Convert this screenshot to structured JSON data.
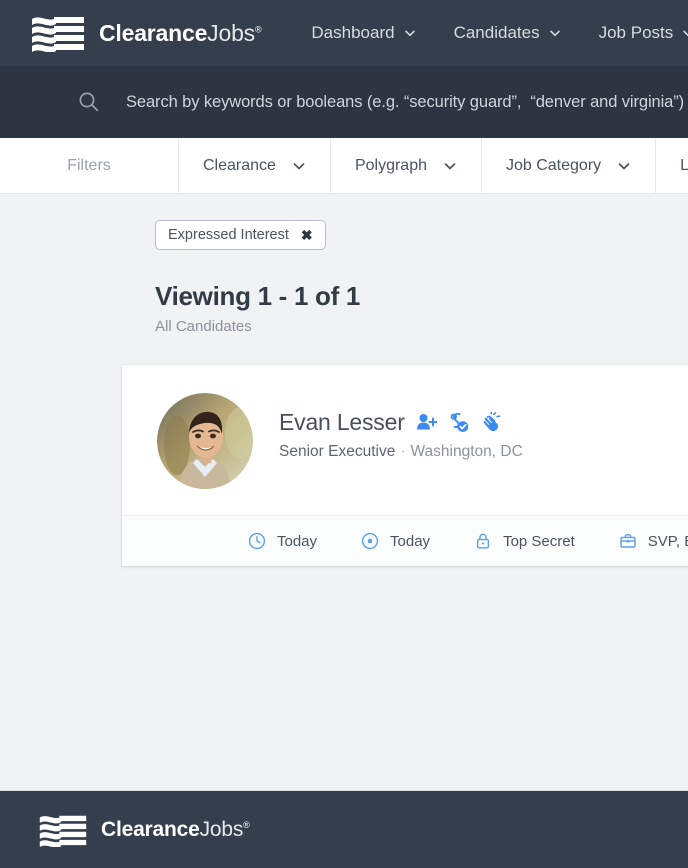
{
  "brand": {
    "name_bold": "Clearance",
    "name_light": "Jobs",
    "registered": "®",
    "logo_icon": "flag-stripes-logo"
  },
  "nav": {
    "items": [
      {
        "label": "Dashboard",
        "icon": "chevron-down-icon"
      },
      {
        "label": "Candidates",
        "icon": "chevron-down-icon"
      },
      {
        "label": "Job Posts",
        "icon": "chevron-down-icon"
      }
    ]
  },
  "search": {
    "icon": "search-icon",
    "value": "",
    "placeholder": "Search by keywords or booleans (e.g. “security guard”,  “denver and virginia”)"
  },
  "filters": {
    "label": "Filters",
    "items": [
      {
        "label": "Clearance",
        "icon": "chevron-down-icon"
      },
      {
        "label": "Polygraph",
        "icon": "chevron-down-icon"
      },
      {
        "label": "Job Category",
        "icon": "chevron-down-icon"
      },
      {
        "label": "Las",
        "icon": "chevron-down-icon"
      }
    ]
  },
  "active_filter_chip": {
    "label": "Expressed Interest",
    "remove_icon": "close-x-icon",
    "remove_label": "✖"
  },
  "results": {
    "heading": "Viewing 1 - 1 of 1",
    "subheading": "All Candidates"
  },
  "tooltip": {
    "text": "Expressed Interest"
  },
  "candidate": {
    "avatar_icon": "avatar-photo",
    "name": "Evan Lesser",
    "title": "Senior Executive",
    "separator": "·",
    "location": "Washington, DC",
    "badges": [
      {
        "icon": "person-add-icon",
        "name": "add-candidate"
      },
      {
        "icon": "saved-check-icon",
        "name": "saved-verified"
      },
      {
        "icon": "waving-hand-icon",
        "name": "expressed-interest"
      }
    ],
    "meta": [
      {
        "icon": "clock-icon",
        "label": "Today"
      },
      {
        "icon": "eye-icon",
        "label": "Today"
      },
      {
        "icon": "lock-icon",
        "label": "Top Secret"
      },
      {
        "icon": "briefcase-icon",
        "label": "SVP, EV"
      }
    ]
  },
  "colors": {
    "navy": "#353e4c",
    "search_band": "#2c3541",
    "page_bg": "#f0f2f3",
    "accent_blue": "#4a90e2",
    "tooltip_bg": "#2f3338"
  }
}
